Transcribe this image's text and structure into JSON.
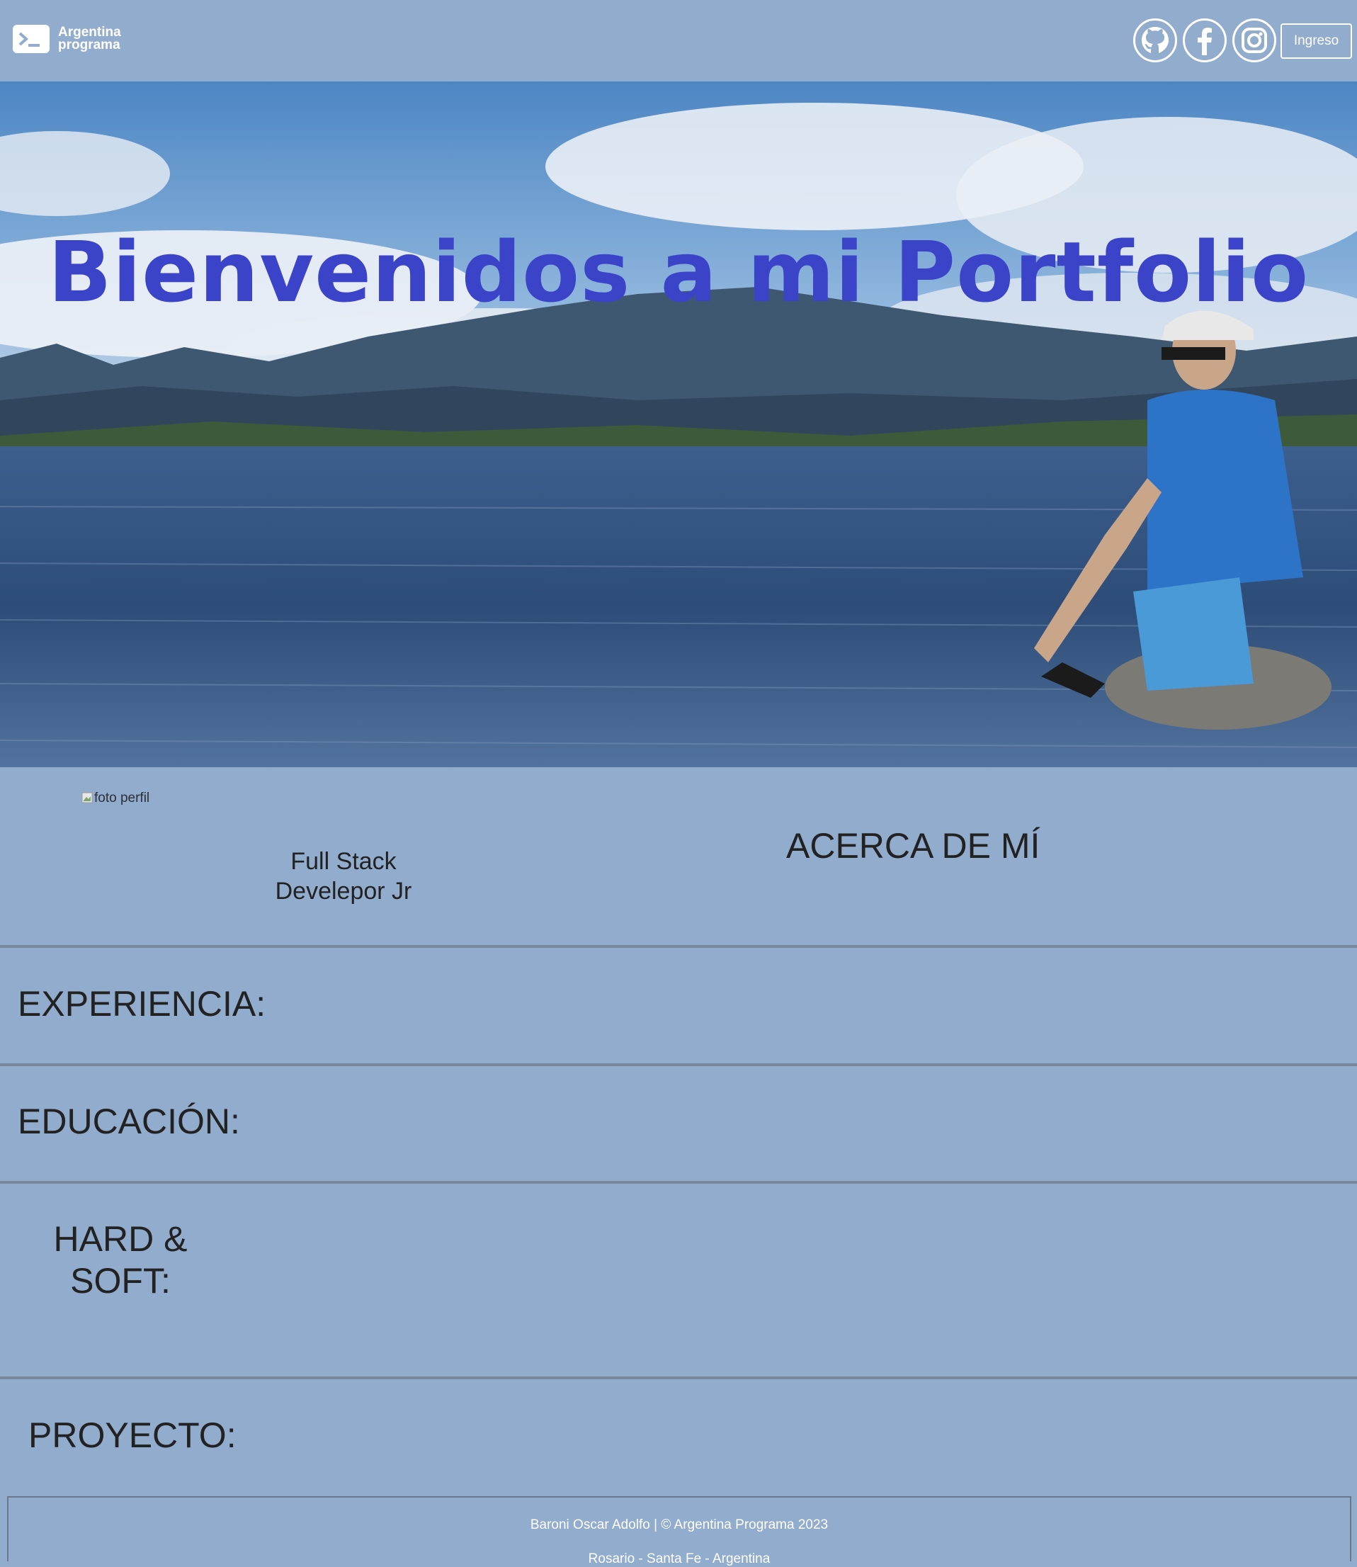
{
  "navbar": {
    "logo_line1": "Argentina",
    "logo_line2": "programa",
    "social_icons": [
      "github-icon",
      "facebook-icon",
      "instagram-icon"
    ],
    "login_label": "Ingreso"
  },
  "hero": {
    "title": "Bienvenidos a mi Portfolio",
    "title_color": "#3b44c8"
  },
  "profile": {
    "photo_alt": "foto perfil",
    "role_line1": "Full Stack",
    "role_line2": "Develepor Jr"
  },
  "sections": {
    "about": "ACERCA DE MÍ",
    "experience": "EXPERIENCIA:",
    "education": "EDUCACIÓN:",
    "skills_line1": "HARD &",
    "skills_line2": "SOFT:",
    "projects": "PROYECTO:"
  },
  "footer": {
    "line1": "Baroni Oscar Adolfo | © Argentina Programa 2023",
    "line2": "Rosario - Santa Fe - Argentina"
  },
  "colors": {
    "background": "#92acce",
    "text": "#222222"
  }
}
